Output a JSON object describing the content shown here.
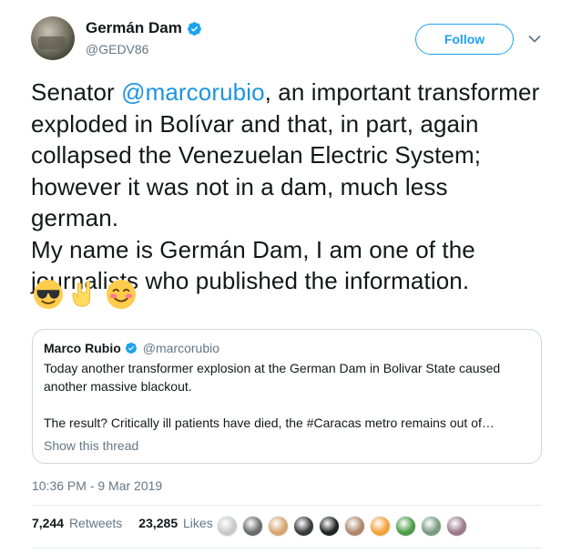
{
  "author": {
    "name": "Germán Dam",
    "handle": "@GEDV86",
    "follow_label": "Follow"
  },
  "tweet": {
    "lines": [
      {
        "prefix": "Senator ",
        "mention": "@marcorubio",
        "suffix": ", an important transformer exploded in Bolívar and that, in part, again collapsed the Venezuelan Electric System; however it was not in a dam, much less german."
      },
      {
        "text": "My name is Germán Dam, I am one of the journalists who published the information."
      }
    ],
    "emojis": [
      "sunglasses-face-emoji",
      "rock-on-hand-emoji",
      "smiling-blush-face-emoji"
    ]
  },
  "quoted": {
    "name": "Marco Rubio",
    "handle": "@marcorubio",
    "line1": "Today another transformer explosion at the German Dam in Bolivar State caused another massive blackout.",
    "line2": "The result? Critically ill patients have died, the #Caracas metro remains out of…",
    "show_thread": "Show this thread"
  },
  "timestamp": "10:36 PM - 9 Mar 2019",
  "stats": {
    "retweets_count": "7,244",
    "retweets_label": "Retweets",
    "likes_count": "23,285",
    "likes_label": "Likes"
  },
  "likers": [
    "#c9c9c9",
    "#6b6b6b",
    "#d8a56e",
    "#3a3a3a",
    "#222222",
    "#b0866a",
    "#f3a23a",
    "#4f9b4a",
    "#7a9a7e",
    "#9b7a8a"
  ],
  "colors": {
    "accent": "#1da1f2",
    "mention": "#1b95e0",
    "muted": "#657786",
    "border": "#ccd6dd"
  }
}
